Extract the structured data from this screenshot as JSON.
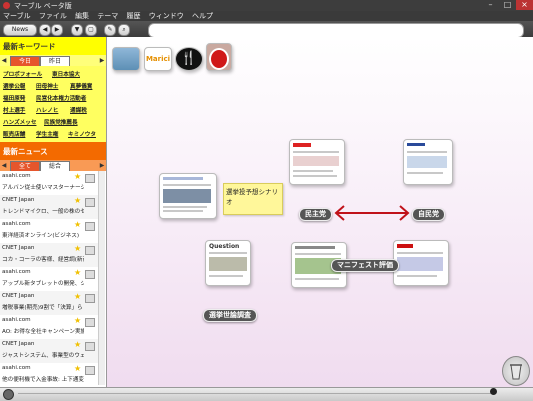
{
  "window": {
    "title": "マーブル ベータ版"
  },
  "menu": [
    "マーブル",
    "ファイル",
    "編集",
    "テーマ",
    "履歴",
    "ウィンドウ",
    "ヘルプ"
  ],
  "toolbar": {
    "news_label": "News",
    "search_placeholder": ""
  },
  "keywords": {
    "heading": "最新キーワード",
    "tabs": [
      "今日",
      "昨日"
    ],
    "items": [
      [
        "プロポフォール",
        "東日本協大"
      ],
      [
        "選挙公報",
        "田母神士",
        "真夢儀賞"
      ],
      [
        "福田原発",
        "民営化本権力活動者"
      ],
      [
        "村上選手",
        "ハレノヒ",
        "通謀税"
      ],
      [
        "ハンズメッセ",
        "民族党推薦長"
      ],
      [
        "販売店舗",
        "学生主権",
        "キミノウタ"
      ]
    ]
  },
  "news": {
    "heading": "最新ニュース",
    "tabs": [
      "全て",
      "総合"
    ],
    "items": [
      {
        "source": "asahi.com",
        "title": "アルバン従士使いマスターナーシティ"
      },
      {
        "source": "CNET Japan",
        "title": "トレンドマイクロ、一般の株のセキュリ"
      },
      {
        "source": "asahi.com",
        "title": "東洋経済オンライン(ビジネス)"
      },
      {
        "source": "CNET Japan",
        "title": "コカ・コーラの客様、経営調(新商業店)"
      },
      {
        "source": "asahi.com",
        "title": "アップル新タブレットの開発、ジョブズ"
      },
      {
        "source": "CNET Japan",
        "title": "増税事業(期売)9割で「決算」ら"
      },
      {
        "source": "asahi.com",
        "title": "AO: お得な全社キャンペーン実施中"
      },
      {
        "source": "CNET Japan",
        "title": "ジャストシステム、事業型のウェブ"
      },
      {
        "source": "asahi.com",
        "title": "他の便利機で入金事故: 上下通変"
      }
    ]
  },
  "canvas": {
    "top_icons": [
      "sky-thumbnail",
      "marici-logo",
      "knife-fork-icon",
      "daruma-icon"
    ],
    "marici_label": "Marici",
    "sticky_note": "選挙投予想シナリオ",
    "labels": {
      "dpj": "民主党",
      "ldp": "自民党",
      "manifesto": "マニフェスト評価",
      "poll": "選挙世論調査"
    },
    "thumb_texts": {
      "question": "Question"
    },
    "relation_color": "#c0121a"
  },
  "colors": {
    "keyword_head": "#ffff00",
    "news_head": "#f36a00",
    "accent": "#e5562c"
  }
}
